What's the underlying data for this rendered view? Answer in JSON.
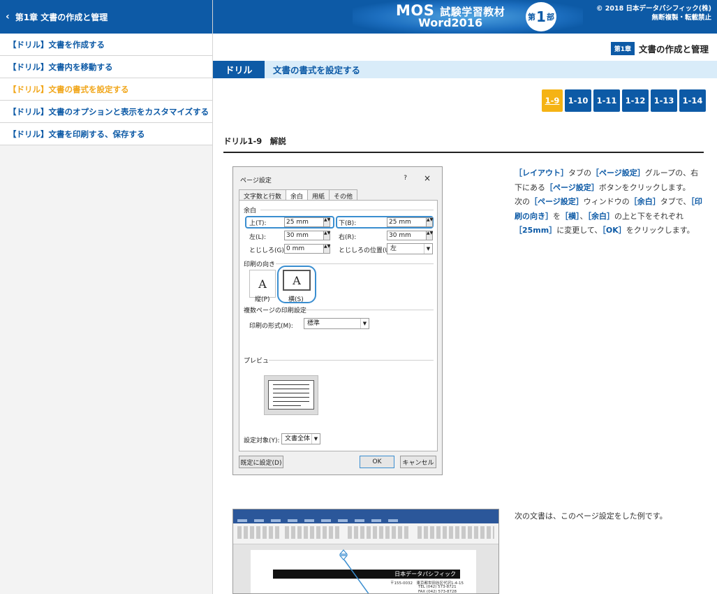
{
  "sidebar": {
    "back_label": "第1章 文書の作成と管理",
    "items": [
      {
        "label": "【ドリル】文書を作成する",
        "active": false
      },
      {
        "label": "【ドリル】文書内を移動する",
        "active": false
      },
      {
        "label": "【ドリル】文書の書式を設定する",
        "active": true
      },
      {
        "label": "【ドリル】文書のオプションと表示をカスタマイズする",
        "active": false
      },
      {
        "label": "【ドリル】文書を印刷する、保存する",
        "active": false
      }
    ]
  },
  "header": {
    "logo_mos": "MOS",
    "logo_sub": "試験学習教材",
    "logo_word": "Word2016",
    "badge_pre": "第",
    "badge_num": "1",
    "badge_post": "部",
    "copyright_line1": "© 2018 日本データパシフィック(株)",
    "copyright_line2": "無断複製・転載禁止"
  },
  "chapter": {
    "tag": "第1章",
    "title": "文書の作成と管理"
  },
  "drill": {
    "label": "ドリル",
    "title": "文書の書式を設定する"
  },
  "pager": {
    "pages": [
      "1-9",
      "1-10",
      "1-11",
      "1-12",
      "1-13",
      "1-14"
    ],
    "current": "1-9"
  },
  "section_title": "ドリル1-9　解説",
  "dialog": {
    "title": "ページ設定",
    "help": "?",
    "close": "×",
    "tabs": [
      "文字数と行数",
      "余白",
      "用紙",
      "その他"
    ],
    "active_tab": "余白",
    "margins_label": "余白",
    "top_label": "上(T):",
    "top_value": "25 mm",
    "bottom_label": "下(B):",
    "bottom_value": "25 mm",
    "left_label": "左(L):",
    "left_value": "30 mm",
    "right_label": "右(R):",
    "right_value": "30 mm",
    "gutter_label": "とじしろ(G):",
    "gutter_value": "0 mm",
    "gutter_pos_label": "とじしろの位置(U):",
    "gutter_pos_value": "左",
    "orientation_label": "印刷の向き",
    "portrait_label": "縦(P)",
    "landscape_label": "横(S)",
    "multi_label": "複数ページの印刷設定",
    "print_form_label": "印刷の形式(M):",
    "print_form_value": "標準",
    "preview_label": "プレビュー",
    "apply_label": "設定対象(Y):",
    "apply_value": "文書全体",
    "default_button": "既定に設定(D)",
    "ok_button": "OK",
    "cancel_button": "キャンセル"
  },
  "explanation": {
    "p1_kw1": "［レイアウト］",
    "p1_t1": "タブの",
    "p1_kw2": "［ページ設定］",
    "p1_t2": "グループの、右下にある",
    "p1_kw3": "［ページ設定］",
    "p1_t3": "ボタンをクリックします。",
    "p2_t1": "次の",
    "p2_kw1": "［ページ設定］",
    "p2_t2": "ウィンドウの",
    "p2_kw2": "［余白］",
    "p2_t3": "タブで、",
    "p2_kw3": "［印刷の向き］",
    "p2_t4": "を",
    "p2_kw4": "［横］",
    "p2_t5": "、",
    "p2_kw5": "［余白］",
    "p2_t6": "の上と下をそれぞれ",
    "p2_kw6": "［25mm］",
    "p2_t7": "に変更して、",
    "p2_kw7": "［OK］",
    "p2_t8": "をクリックします。"
  },
  "example_text": "次の文書は、このページ設定をした例です。",
  "word_doc": {
    "company": "日本データパシフィック",
    "addr1": "〒155-0032　東京都世田谷区代沢1-4-15",
    "addr2": "TEL (042) 573-8721",
    "addr3": "FAX (042) 573-8728"
  }
}
